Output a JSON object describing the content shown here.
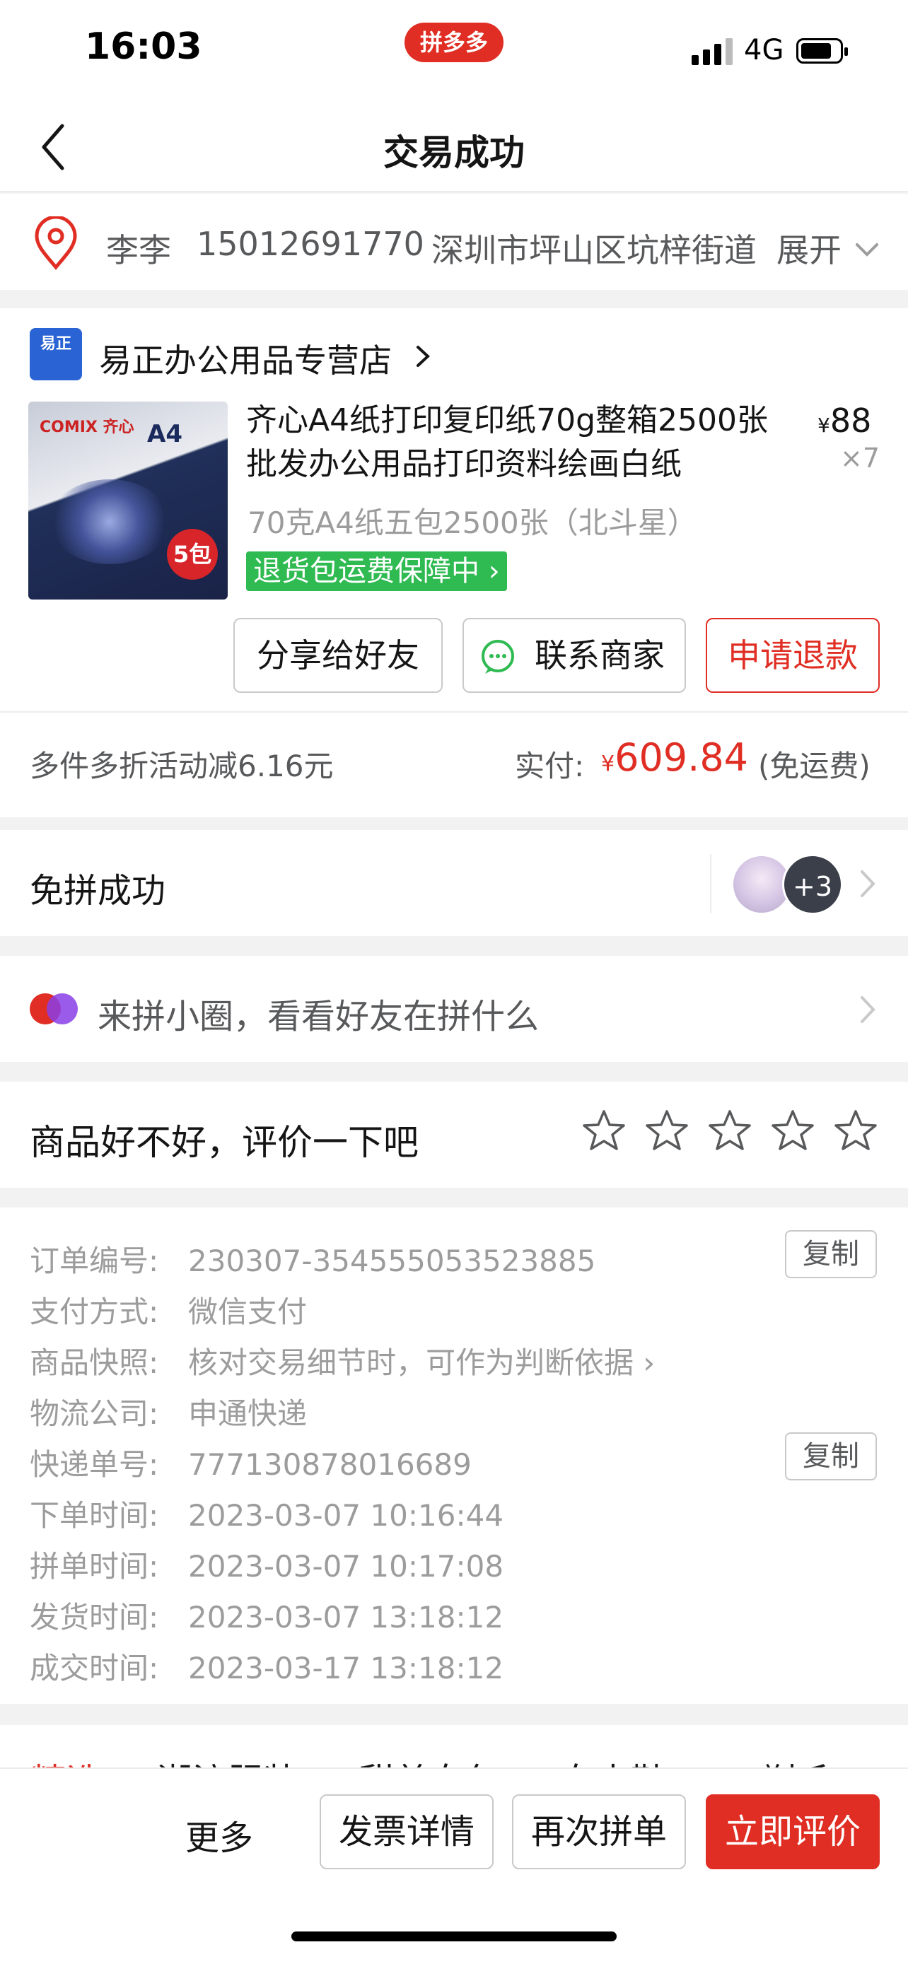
{
  "status_bar": {
    "time": "16:03",
    "app_badge": "拼多多",
    "network": "4G"
  },
  "nav": {
    "title": "交易成功"
  },
  "address": {
    "name": "李李",
    "phone": "15012691770",
    "text": "深圳市坪山区坑梓街道",
    "expand_label": "展开"
  },
  "store": {
    "logo_text": "易正",
    "name": "易正办公用品专营店"
  },
  "product": {
    "image_brand": "COMIX 齐心",
    "image_label": "A4",
    "image_badge": "5包",
    "title": "齐心A4纸打印复印纸70g整箱2500张批发办公用品打印资料绘画白纸",
    "currency": "¥",
    "price": "88",
    "quantity": "×7",
    "spec": "70克A4纸五包2500张（北斗星）",
    "guarantee_tag": "退货包运费保障中 ›"
  },
  "actions": {
    "share": "分享给好友",
    "contact": "联系商家",
    "refund": "申请退款"
  },
  "payment": {
    "discount": "多件多折活动减6.16元",
    "paid_label": "实付:",
    "currency": "¥",
    "paid_amount": "609.84",
    "shipping": "(免运费)"
  },
  "group": {
    "label": "免拼成功",
    "more_count": "+3"
  },
  "circle": {
    "label": "来拼小圈，看看好友在拼什么"
  },
  "review": {
    "label": "商品好不好，评价一下吧",
    "rating": 0,
    "max_rating": 5
  },
  "order_info": {
    "rows": [
      {
        "key": "订单编号:",
        "value": "230307-354555053523885"
      },
      {
        "key": "支付方式:",
        "value": "微信支付"
      },
      {
        "key": "商品快照:",
        "value": "核对交易细节时，可作为判断依据 ›"
      },
      {
        "key": "物流公司:",
        "value": "申通快递"
      },
      {
        "key": "快递单号:",
        "value": "777130878016689"
      },
      {
        "key": "下单时间:",
        "value": "2023-03-07 10:16:44"
      },
      {
        "key": "拼单时间:",
        "value": "2023-03-07 10:17:08"
      },
      {
        "key": "发货时间:",
        "value": "2023-03-07 13:18:12"
      },
      {
        "key": "成交时间:",
        "value": "2023-03-17 13:18:12"
      }
    ],
    "copy_label": "复制"
  },
  "tabs": [
    "精选",
    "潮流服装",
    "甜美女包",
    "女士鞋",
    "剃毛刀"
  ],
  "bottom": {
    "more": "更多",
    "invoice": "发票详情",
    "reorder": "再次拼单",
    "rate": "立即评价"
  },
  "colors": {
    "brand_red": "#e02e24",
    "guarantee_green": "#2fba52",
    "store_blue": "#2a63d4"
  }
}
